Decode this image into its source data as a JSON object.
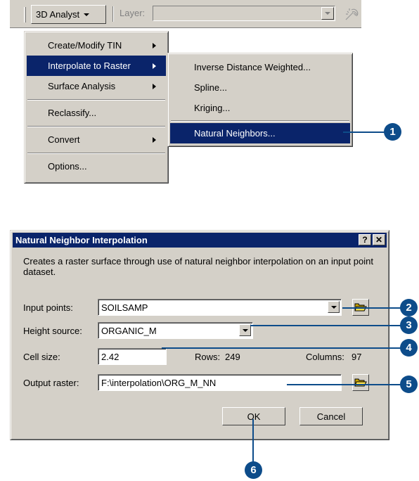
{
  "toolbar": {
    "analyst_menu_label": "3D Analyst",
    "layer_label": "Layer:",
    "layer_value": ""
  },
  "menu_3d_analyst": {
    "items": [
      {
        "label": "Create/Modify TIN",
        "has_submenu": true
      },
      {
        "label": "Interpolate to Raster",
        "has_submenu": true,
        "highlighted": true
      },
      {
        "label": "Surface Analysis",
        "has_submenu": true
      },
      {
        "label": "Reclassify..."
      },
      {
        "label": "Convert",
        "has_submenu": true
      },
      {
        "label": "Options..."
      }
    ]
  },
  "submenu_interpolate": {
    "items": [
      {
        "label": "Inverse Distance Weighted..."
      },
      {
        "label": "Spline..."
      },
      {
        "label": "Kriging..."
      },
      {
        "label": "Natural Neighbors...",
        "highlighted": true
      }
    ]
  },
  "dialog": {
    "title": "Natural Neighbor Interpolation",
    "help_button": "?",
    "close_button": "✕",
    "description": "Creates a raster surface through use of natural neighbor interpolation on an input point dataset.",
    "input_points_label": "Input points:",
    "input_points_value": "SOILSAMP",
    "height_source_label": "Height source:",
    "height_source_value": "ORGANIC_M",
    "cell_size_label": "Cell size:",
    "cell_size_value": "2.42",
    "rows_label": "Rows:",
    "rows_value": "249",
    "columns_label": "Columns:",
    "columns_value": "97",
    "output_raster_label": "Output raster:",
    "output_raster_value": "F:\\interpolation\\ORG_M_NN",
    "ok_label": "OK",
    "cancel_label": "Cancel"
  },
  "callouts": [
    "1",
    "2",
    "3",
    "4",
    "5",
    "6"
  ],
  "colors": {
    "face": "#d4d0c8",
    "highlight": "#0a246a",
    "callout": "#0d4c8a"
  },
  "icons": [
    "menu-dropdown-icon",
    "submenu-arrow-icon",
    "combo-dropdown-icon",
    "open-folder-icon",
    "magic-wand-icon"
  ]
}
